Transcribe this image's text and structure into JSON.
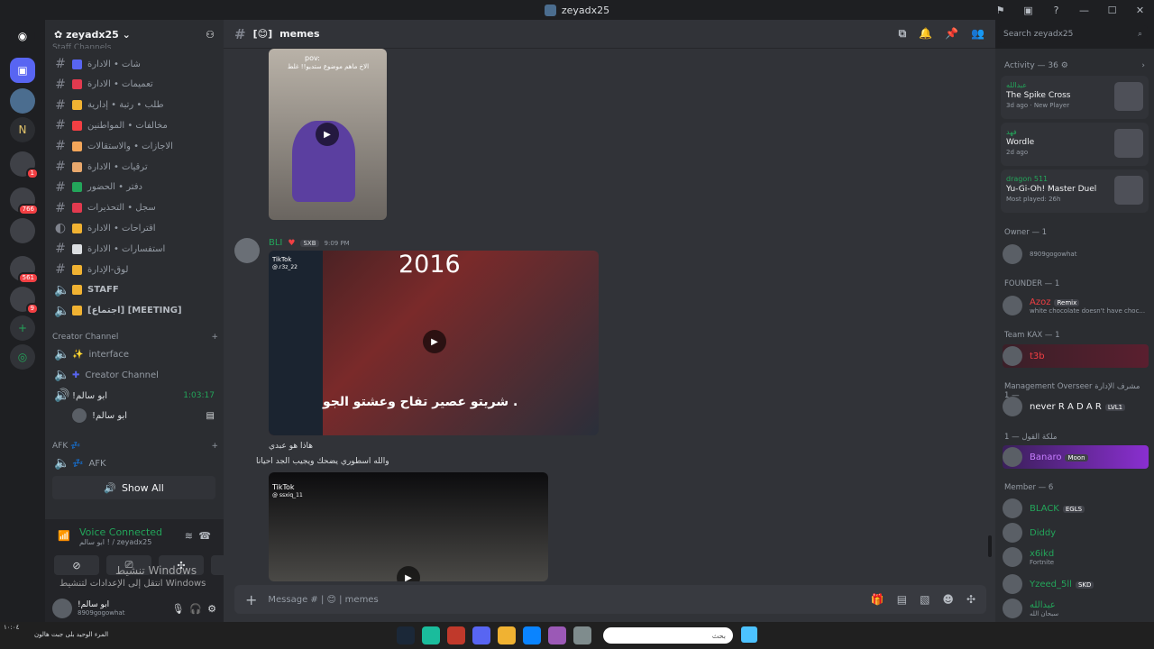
{
  "titlebar": {
    "title": "zeyadx25"
  },
  "server": {
    "name": "zeyadx25",
    "cut_category": "Staff Channels"
  },
  "channels": [
    {
      "label": "شات • الادارة",
      "color": "#5865f2"
    },
    {
      "label": "تعميمات • الادارة",
      "color": "#e23a4f"
    },
    {
      "label": "طلب • رتبة • إدارية",
      "color": "#f0b232"
    },
    {
      "label": "مخالفات • المواطنين",
      "color": "#f23f43"
    },
    {
      "label": "الاجازات • والاستقالات",
      "color": "#f2a65a"
    },
    {
      "label": "ترقيات • الادارة",
      "color": "#e8a86d"
    },
    {
      "label": "دفتر • الحضور",
      "color": "#23a55a"
    },
    {
      "label": "سجل • التحذيرات",
      "color": "#e23a4f"
    },
    {
      "label": "اقتراحات • الادارة",
      "color": "#f0b232"
    },
    {
      "label": "استفسارات • الادارة",
      "color": "#dbdee1"
    },
    {
      "label": "لوق-الإدارة",
      "color": "#f0b232"
    },
    {
      "label": "STAFF",
      "color": "#f0b232"
    },
    {
      "label": "[اجتماع] [MEETING]",
      "color": "#f0b232"
    }
  ],
  "creator": {
    "category": "Creator Channel",
    "interface": "interface",
    "create": "Creator Channel",
    "voice_label": "!ابو سالم",
    "timer": "1:03:17",
    "member": "!ابو سالم"
  },
  "afk": {
    "category": "AFK",
    "channel": "AFK",
    "show_all": "Show All"
  },
  "voice": {
    "status": "Voice Connected",
    "sub": "ابو سالم ! / zeyadx25"
  },
  "user": {
    "name": "!ابو سالم",
    "status": "8909gogowhat"
  },
  "windows": {
    "line1": "تنشيط Windows",
    "line2": "انتقل إلى الإعدادات لتنشيط Windows"
  },
  "channel": {
    "name": "memes",
    "search": "Search zeyadx25"
  },
  "post1": {
    "caption": "pov:",
    "caption2": "الاخ ماهم موضوع ستديو!! غلط"
  },
  "message": {
    "author": "BLI",
    "tag": "SXB",
    "time": "9:09 PM",
    "video_year": "2016",
    "video_text": "شريتو عصير تفاح وعشتو الجو .",
    "video_brand": "TikTok",
    "video_handle": "@.r3z_22",
    "line1": "هاذا هو عبدي",
    "line2": "والله اسطوري يضحك ويجيب الجد احيانا",
    "tiktok2": "TikTok",
    "handle2": "@ ssxiq_11"
  },
  "composer": {
    "placeholder": "Message # | 😊 | memes"
  },
  "activity": {
    "title": "Activity — 36"
  },
  "cards": [
    {
      "user": "عبدالله",
      "game": "The Spike Cross",
      "meta": "3d ago · New Player"
    },
    {
      "user": "فهد",
      "game": "Wordle",
      "meta": "2d ago"
    },
    {
      "user": "dragon 511",
      "game": "Yu-Gi-Oh! Master Duel",
      "meta": "Most played: 26h"
    }
  ],
  "groups": {
    "owner": "Owner — 1",
    "founder": "FOUNDER — 1",
    "teamkax": "Team KAX — 1",
    "mgmt": "Management Overseer مشرف الإدارة — 1",
    "queen": "ملكة القول — 1",
    "member": "Member — 6"
  },
  "members": [
    {
      "name": "",
      "sub": "8909gogowhat",
      "color": "#dbdee1"
    },
    {
      "name": "Azoz",
      "sub": "white chocolate doesn't have choc...",
      "color": "#f23f43",
      "tag": "Remix"
    },
    {
      "name": "t3b",
      "sub": "",
      "color": "#f23f43"
    },
    {
      "name": "never R A D A R",
      "sub": "",
      "color": "#f2f3f5",
      "tag": "LVL1"
    },
    {
      "name": "Banaro",
      "sub": "",
      "color": "#c77dff",
      "tag": "Moon"
    },
    {
      "name": "BLACK",
      "sub": "",
      "color": "#23a55a",
      "tag": "EGLS"
    },
    {
      "name": "Diddy",
      "sub": "",
      "color": "#23a55a"
    },
    {
      "name": "x6ikd",
      "sub": "Fortnite",
      "color": "#23a55a"
    },
    {
      "name": "Yzeed_5ll",
      "sub": "",
      "color": "#23a55a",
      "tag": "SKD"
    },
    {
      "name": "عبدالله",
      "sub": "سبحان الله",
      "color": "#23a55a"
    }
  ],
  "taskbar": {
    "search": "بحث",
    "time": "١٠:٠٤",
    "news": "المرء الوحيد بلى جبت هالون"
  }
}
